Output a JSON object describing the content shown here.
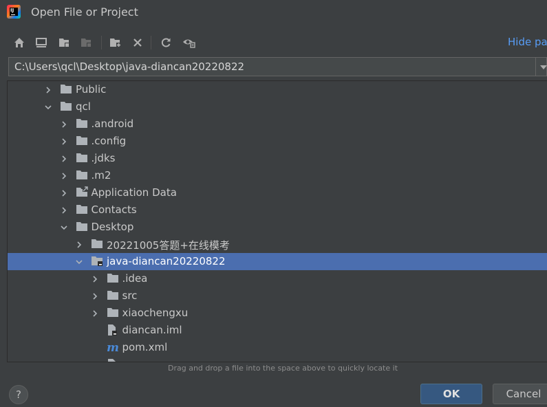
{
  "window": {
    "title": "Open File or Project"
  },
  "toolbar": {
    "buttons": [
      {
        "name": "home-icon"
      },
      {
        "name": "desktop-icon"
      },
      {
        "name": "project-folder-icon"
      },
      {
        "name": "module-folder-icon"
      },
      {
        "name": "new-folder-icon"
      },
      {
        "name": "delete-icon"
      },
      {
        "name": "refresh-icon"
      },
      {
        "name": "show-hidden-icon"
      }
    ],
    "hide_path_label": "Hide pa"
  },
  "path": {
    "value": "C:\\Users\\qcl\\Desktop\\java-diancan20220822"
  },
  "tree": {
    "rows": [
      {
        "label": "Public",
        "arrow": "right",
        "icon": "folder"
      },
      {
        "label": "qcl",
        "arrow": "down",
        "icon": "folder"
      },
      {
        "label": ".android",
        "arrow": "right",
        "icon": "folder"
      },
      {
        "label": ".config",
        "arrow": "right",
        "icon": "folder"
      },
      {
        "label": ".jdks",
        "arrow": "right",
        "icon": "folder"
      },
      {
        "label": ".m2",
        "arrow": "right",
        "icon": "folder"
      },
      {
        "label": "Application Data",
        "arrow": "right",
        "icon": "folder-link"
      },
      {
        "label": "Contacts",
        "arrow": "right",
        "icon": "folder"
      },
      {
        "label": "Desktop",
        "arrow": "down",
        "icon": "folder"
      },
      {
        "label": "20221005答题+在线模考",
        "arrow": "right",
        "icon": "folder"
      },
      {
        "label": "java-diancan20220822",
        "arrow": "down",
        "icon": "project-folder",
        "selected": true
      },
      {
        "label": ".idea",
        "arrow": "right",
        "icon": "folder"
      },
      {
        "label": "src",
        "arrow": "right",
        "icon": "folder"
      },
      {
        "label": "xiaochengxu",
        "arrow": "right",
        "icon": "folder"
      },
      {
        "label": "diancan.iml",
        "arrow": "none",
        "icon": "iml-file"
      },
      {
        "label": "pom.xml",
        "arrow": "none",
        "icon": "maven-file"
      },
      {
        "label": "",
        "arrow": "none",
        "icon": "file"
      }
    ]
  },
  "hint": "Drag and drop a file into the space above to quickly locate it",
  "buttons": {
    "help": "?",
    "ok": "OK",
    "cancel": "Cancel"
  },
  "colors": {
    "background": "#3c3f41",
    "selection": "#4b6eaf",
    "link": "#589df6",
    "ok_button": "#365880"
  }
}
